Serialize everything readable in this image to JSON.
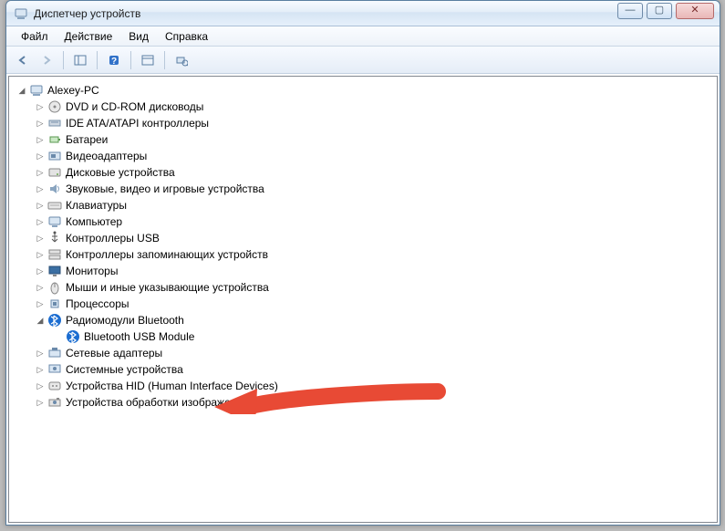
{
  "window": {
    "title": "Диспетчер устройств"
  },
  "menu": {
    "file": "Файл",
    "action": "Действие",
    "view": "Вид",
    "help": "Справка"
  },
  "tree": {
    "root": "Alexey-PC",
    "items": [
      {
        "icon": "disc",
        "label": "DVD и CD-ROM дисководы"
      },
      {
        "icon": "ide",
        "label": "IDE ATA/ATAPI контроллеры"
      },
      {
        "icon": "battery",
        "label": "Батареи"
      },
      {
        "icon": "video",
        "label": "Видеоадаптеры"
      },
      {
        "icon": "disk",
        "label": "Дисковые устройства"
      },
      {
        "icon": "sound",
        "label": "Звуковые, видео и игровые устройства"
      },
      {
        "icon": "keyboard",
        "label": "Клавиатуры"
      },
      {
        "icon": "computer",
        "label": "Компьютер"
      },
      {
        "icon": "usb",
        "label": "Контроллеры USB"
      },
      {
        "icon": "storage",
        "label": "Контроллеры запоминающих устройств"
      },
      {
        "icon": "monitor",
        "label": "Мониторы"
      },
      {
        "icon": "mouse",
        "label": "Мыши и иные указывающие устройства"
      },
      {
        "icon": "cpu",
        "label": "Процессоры"
      },
      {
        "icon": "bluetooth",
        "label": "Радиомодули Bluetooth",
        "expanded": true,
        "children": [
          {
            "icon": "bluetooth",
            "label": "Bluetooth USB Module"
          }
        ]
      },
      {
        "icon": "network",
        "label": "Сетевые адаптеры"
      },
      {
        "icon": "system",
        "label": "Системные устройства"
      },
      {
        "icon": "hid",
        "label": "Устройства HID (Human Interface Devices)"
      },
      {
        "icon": "imaging",
        "label": "Устройства обработки изображений"
      }
    ]
  }
}
